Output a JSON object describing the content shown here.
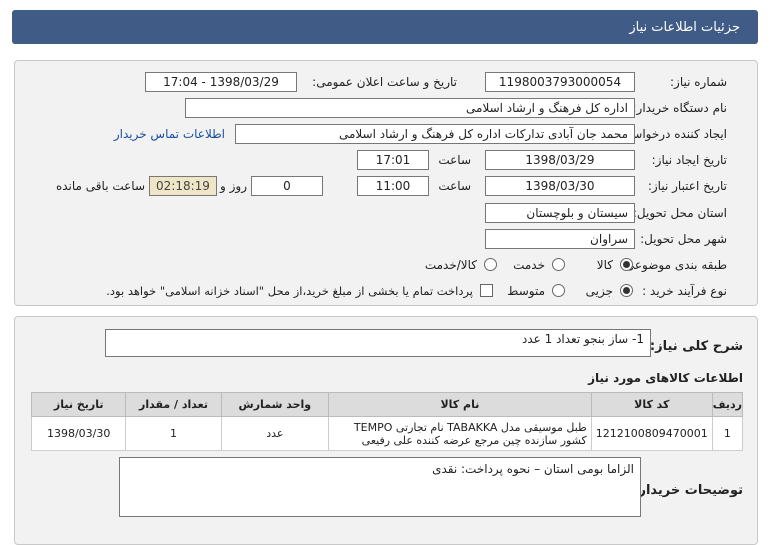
{
  "header": {
    "title": "جزئیات اطلاعات نیاز"
  },
  "form": {
    "need_number": {
      "label": "شماره نیاز:",
      "value": "1198003793000054"
    },
    "announce_date": {
      "label": "تاریخ و ساعت اعلان عمومی:",
      "value": "1398/03/29 - 17:04"
    },
    "buyer_org": {
      "label": "نام دستگاه خریدار:",
      "value": "اداره کل فرهنگ و ارشاد اسلامی"
    },
    "requester": {
      "label": "ایجاد کننده درخواست:",
      "value": "محمد جان آبادی تدارکات اداره کل فرهنگ و ارشاد اسلامی",
      "contact_link": "اطلاعات تماس خریدار"
    },
    "created": {
      "label": "تاریخ ایجاد نیاز:",
      "date": "1398/03/29",
      "time_label": "ساعت",
      "time": "17:01"
    },
    "validity": {
      "label": "تاریخ اعتبار نیاز:",
      "date": "1398/03/30",
      "time_label": "ساعت",
      "time": "11:00",
      "days": "0",
      "days_label": "روز و",
      "remaining": "02:18:19",
      "remaining_label": "ساعت باقی مانده"
    },
    "province": {
      "label": "استان محل تحویل:",
      "value": "سیستان و بلوچستان"
    },
    "city": {
      "label": "شهر محل تحویل:",
      "value": "سراوان"
    },
    "category": {
      "label": "طبقه بندی موضوعی:",
      "options": [
        "کالا",
        "خدمت",
        "کالا/خدمت"
      ],
      "selected": "کالا"
    },
    "purchase_type": {
      "label": "نوع فرآیند خرید :",
      "options": [
        "جزیی",
        "متوسط"
      ],
      "selected": "جزیی",
      "checkbox_text": "پرداخت تمام یا بخشی از مبلغ خرید،از محل \"اسناد خزانه اسلامی\" خواهد بود."
    }
  },
  "summary": {
    "label": "شرح کلی نیاز:",
    "value": "1- ساز بنجو تعداد 1 عدد"
  },
  "items": {
    "title": "اطلاعات کالاهای مورد نیاز",
    "columns": [
      "ردیف",
      "کد کالا",
      "نام کالا",
      "واحد شمارش",
      "تعداد / مقدار",
      "تاریخ نیاز"
    ],
    "rows": [
      {
        "row": "1",
        "code": "1212100809470001",
        "name": "طبل موسیقی مدل TABAKKA نام تجارتی TEMPO کشور سازنده چین مرجع عرضه کننده علی رفیعی",
        "unit": "عدد",
        "qty": "1",
        "date": "1398/03/30"
      }
    ]
  },
  "buyer_notes": {
    "label": "توضیحات خریدار:",
    "value": "الزاما بومی استان – نحوه پرداخت: نقدی"
  }
}
